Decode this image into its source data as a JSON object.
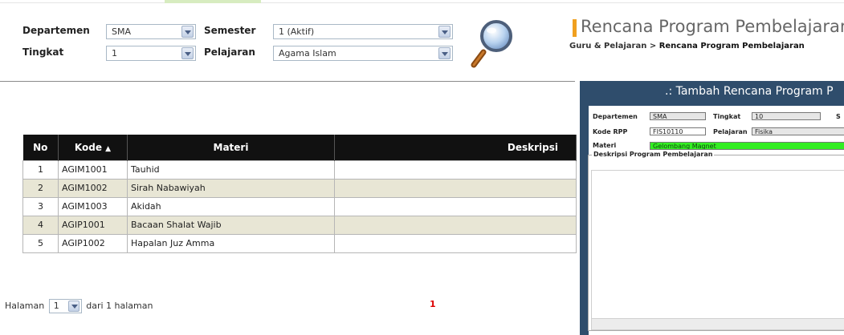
{
  "filter": {
    "departemen_label": "Departemen",
    "departemen_value": "SMA",
    "tingkat_label": "Tingkat",
    "tingkat_value": "1",
    "semester_label": "Semester",
    "semester_value": "1 (Aktif)",
    "pelajaran_label": "Pelajaran",
    "pelajaran_value": "Agama Islam",
    "search_icon": "magnifier-icon"
  },
  "header": {
    "title": "Rencana Program Pembelajaran",
    "breadcrumb_parent": "Guru & Pelajaran",
    "breadcrumb_sep": ">",
    "breadcrumb_current": "Rencana Program Pembelajaran"
  },
  "table": {
    "columns": [
      "No",
      "Kode",
      "Materi",
      "Deskripsi"
    ],
    "sort_indicator": "▲",
    "rows": [
      {
        "no": "1",
        "kode": "AGIM1001",
        "materi": "Tauhid",
        "deskripsi": ""
      },
      {
        "no": "2",
        "kode": "AGIM1002",
        "materi": "Sirah Nabawiyah",
        "deskripsi": ""
      },
      {
        "no": "3",
        "kode": "AGIM1003",
        "materi": "Akidah",
        "deskripsi": ""
      },
      {
        "no": "4",
        "kode": "AGIP1001",
        "materi": "Bacaan Shalat Wajib",
        "deskripsi": ""
      },
      {
        "no": "5",
        "kode": "AGIP1002",
        "materi": "Hapalan Juz Amma",
        "deskripsi": ""
      }
    ]
  },
  "pager": {
    "prefix": "Halaman",
    "page_value": "1",
    "suffix": "dari 1 halaman",
    "page_link": "1"
  },
  "dialog": {
    "title": ".: Tambah Rencana Program P",
    "departemen_label": "Departemen",
    "departemen_value": "SMA",
    "tingkat_label": "Tingkat",
    "tingkat_value": "10",
    "semester_cut_label": "S",
    "kode_label": "Kode RPP",
    "kode_value": "FIS10110",
    "pelajaran_label": "Pelajaran",
    "pelajaran_value": "Fisika",
    "materi_label": "Materi",
    "materi_value": "Gelombang Magnet",
    "deskripsi_legend": "Deskripsi Program Pembelajaran"
  },
  "colors": {
    "header_row": "#111111",
    "alt_row": "#e8e6d5",
    "dialog_bg": "#2f4d6c",
    "accent_bar": "#f0a020",
    "page_link": "#dd0000",
    "materi_field": "#33ee22"
  }
}
